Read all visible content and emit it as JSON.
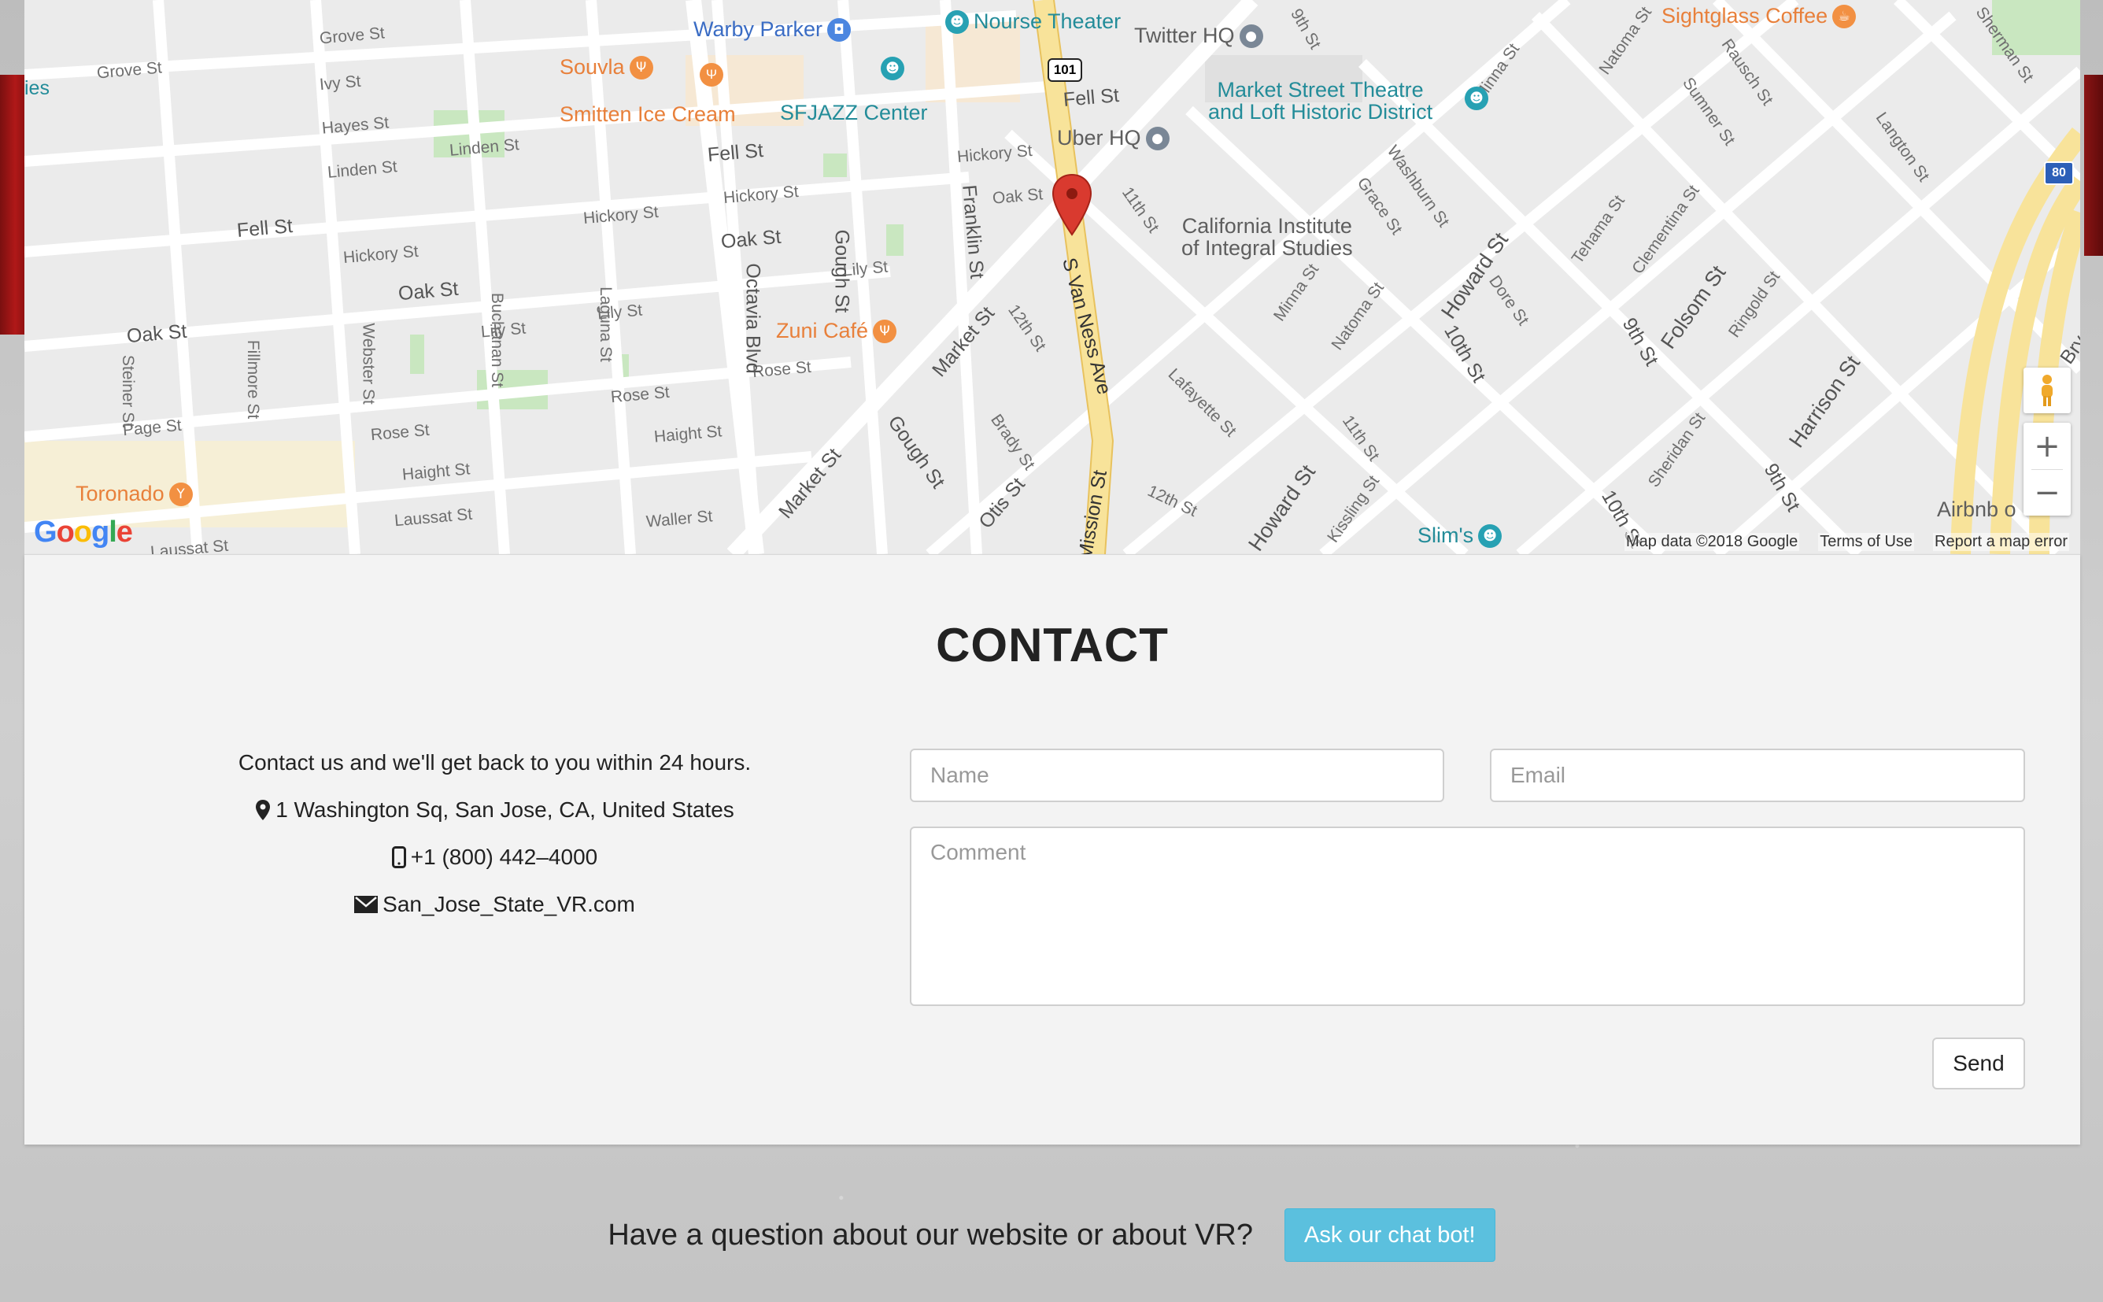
{
  "map": {
    "streets": [
      "Grove St",
      "Grove St",
      "Ivy St",
      "Hayes St",
      "Linden St",
      "Linden St",
      "Fell St",
      "Fell St",
      "Fell St",
      "Hickory St",
      "Hickory St",
      "Hickory St",
      "Hickory St",
      "Oak St",
      "Oak St",
      "Oak St",
      "Oak St",
      "Oak St",
      "Lily St",
      "Lily St",
      "Lily St",
      "Page St",
      "Rose St",
      "Rose St",
      "Rose St",
      "Haight St",
      "Haight St",
      "Laussat St",
      "Laussat St",
      "Waller St",
      "Steiner St",
      "Fillmore St",
      "Webster St",
      "Buchanan St",
      "Laguna St",
      "Octavia Blvd",
      "Gough St",
      "Gough St",
      "Franklin St",
      "Market St",
      "Market St",
      "12th St",
      "12th St",
      "11th St",
      "11th St",
      "10th St",
      "10th St",
      "9th St",
      "9th St",
      "9th St",
      "S Van Ness Ave",
      "Mission St",
      "Brady St",
      "Otis St",
      "Lafayette St",
      "Minna St",
      "Minna St",
      "Natoma St",
      "Natoma St",
      "Grace St",
      "Washburn St",
      "Howard St",
      "Howard St",
      "Dore St",
      "Tehama St",
      "Clementina St",
      "Folsom St",
      "Ringold St",
      "Harrison St",
      "Sheridan St",
      "Kissling St",
      "Langton St",
      "Rausch St",
      "Sumner St",
      "Sherman St",
      "Bry",
      "ies"
    ],
    "pois": [
      {
        "name": "Warby Parker",
        "color": "blue",
        "icon": "shopping-bag-icon"
      },
      {
        "name": "Nourse Theater",
        "color": "teal",
        "icon": "theater-icon"
      },
      {
        "name": "Twitter HQ",
        "color": "gray",
        "icon": "location-icon"
      },
      {
        "name": "Sightglass Coffee",
        "color": "orange",
        "icon": "coffee-icon"
      },
      {
        "name": "Souvla",
        "color": "orange",
        "icon": "restaurant-icon"
      },
      {
        "name": "Smitten Ice Cream",
        "color": "orange",
        "icon": "restaurant-icon"
      },
      {
        "name": "SFJAZZ Center",
        "color": "teal",
        "icon": "theater-icon"
      },
      {
        "name": "Uber HQ",
        "color": "gray",
        "icon": "location-icon"
      },
      {
        "name": "Market Street Theatre",
        "color": "teal",
        "icon": "theater-icon"
      },
      {
        "name": "and Loft Historic District",
        "color": "teal",
        "icon": "none"
      },
      {
        "name": "California Institute",
        "color": "gray",
        "icon": "none"
      },
      {
        "name": "of Integral Studies",
        "color": "gray",
        "icon": "none"
      },
      {
        "name": "Zuni Café",
        "color": "orange",
        "icon": "restaurant-icon"
      },
      {
        "name": "Toronado",
        "color": "orange",
        "icon": "bar-icon"
      },
      {
        "name": "Slim's",
        "color": "teal",
        "icon": "theater-icon"
      },
      {
        "name": "Airbnb o",
        "color": "gray",
        "icon": "location-icon"
      }
    ],
    "shields": [
      "101",
      "80"
    ],
    "logo": "Google",
    "footer": {
      "data": "Map data ©2018 Google",
      "terms": "Terms of Use",
      "report": "Report a map error"
    },
    "zoom_in": "+",
    "zoom_out": "−"
  },
  "contact": {
    "heading": "CONTACT",
    "intro": "Contact us and we'll get back to you within 24 hours.",
    "address": "1 Washington Sq, San Jose, CA, United States",
    "phone": "+1 (800) 442–4000",
    "email": "San_Jose_State_VR.com",
    "icons": {
      "address": "map-marker-icon",
      "phone": "phone-icon",
      "email": "envelope-icon"
    },
    "form": {
      "name_placeholder": "Name",
      "email_placeholder": "Email",
      "comment_placeholder": "Comment",
      "send_label": "Send"
    }
  },
  "footer": {
    "question": "Have a question about our website or about VR?",
    "chat_button": "Ask our chat bot!",
    "chat_button_color": "#5bc0de"
  },
  "colors": {
    "marker": "#d93a2f",
    "highway": "#f8e39a",
    "panel_bg": "#f3f3f3"
  }
}
